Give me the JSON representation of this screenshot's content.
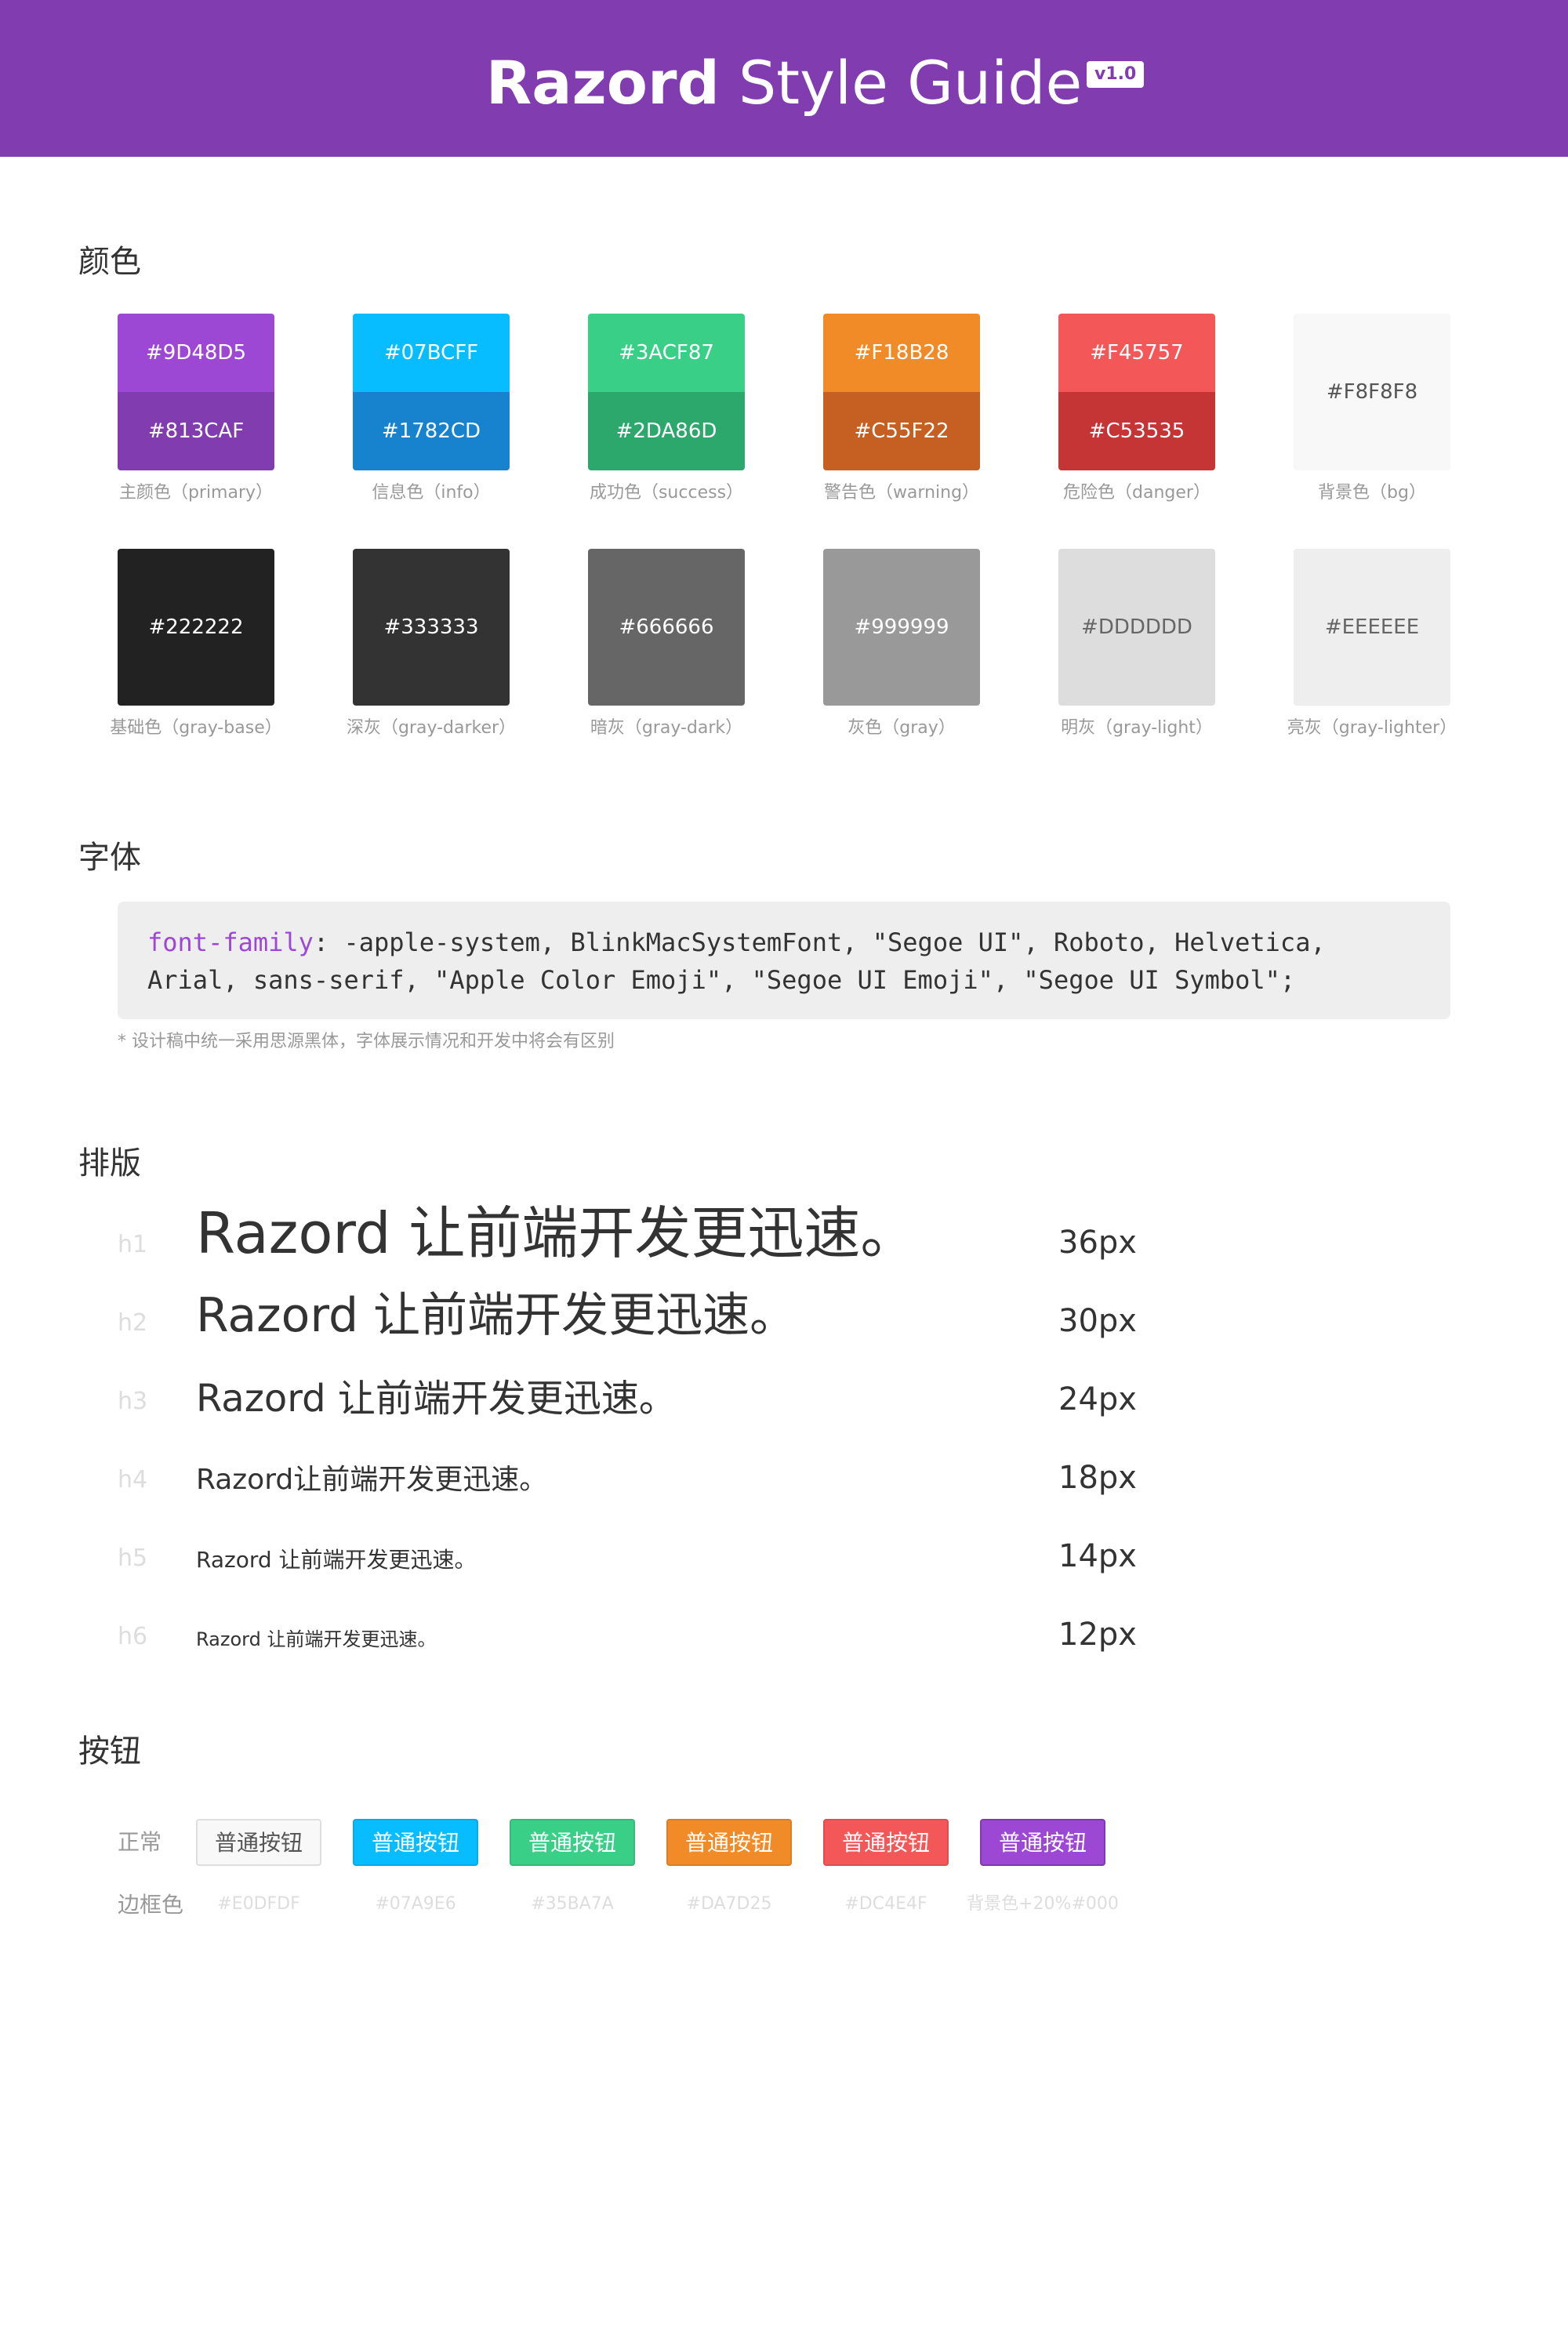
{
  "header": {
    "title_bold": "Razord",
    "title_light": "Style Guide",
    "version": "v1.0",
    "background": "#813CAF"
  },
  "colors_section": {
    "title": "颜色",
    "swatches_top": [
      {
        "top_value": "#9D48D5",
        "bottom_value": "#813CAF",
        "caption": "主颜色（primary）"
      },
      {
        "top_value": "#07BCFF",
        "bottom_value": "#1782CD",
        "caption": "信息色（info）"
      },
      {
        "top_value": "#3ACF87",
        "bottom_value": "#2DA86D",
        "caption": "成功色（success）"
      },
      {
        "top_value": "#F18B28",
        "bottom_value": "#C55F22",
        "caption": "警告色（warning）"
      },
      {
        "top_value": "#F45757",
        "bottom_value": "#C53535",
        "caption": "危险色（danger）"
      },
      {
        "value": "#F8F8F8",
        "caption": "背景色（bg）"
      }
    ],
    "swatches_gray": [
      {
        "value": "#222222",
        "caption": "基础色（gray-base）"
      },
      {
        "value": "#333333",
        "caption": "深灰（gray-darker）"
      },
      {
        "value": "#666666",
        "caption": "暗灰（gray-dark）"
      },
      {
        "value": "#999999",
        "caption": "灰色（gray）"
      },
      {
        "value": "#DDDDDD",
        "caption": "明灰（gray-light）"
      },
      {
        "value": "#EEEEEE",
        "caption": "亮灰（gray-lighter）"
      }
    ]
  },
  "font_section": {
    "title": "字体",
    "keyword": "font-family",
    "line1_rest": ": -apple-system, BlinkMacSystemFont, \"Segoe UI\", Roboto, Helvetica,",
    "line2": "Arial, sans-serif, \"Apple Color Emoji\", \"Segoe UI Emoji\", \"Segoe UI Symbol\";",
    "note": "* 设计稿中统一采用思源黑体，字体展示情况和开发中将会有区别"
  },
  "typography_section": {
    "title": "排版",
    "rows": [
      {
        "label": "h1",
        "sample": "Razord 让前端开发更迅速。",
        "size": "36px"
      },
      {
        "label": "h2",
        "sample": "Razord 让前端开发更迅速。",
        "size": "30px"
      },
      {
        "label": "h3",
        "sample": "Razord 让前端开发更迅速。",
        "size": "24px"
      },
      {
        "label": "h4",
        "sample": "Razord让前端开发更迅速。",
        "size": "18px"
      },
      {
        "label": "h5",
        "sample": "Razord 让前端开发更迅速。",
        "size": "14px"
      },
      {
        "label": "h6",
        "sample": "Razord 让前端开发更迅速。",
        "size": "12px"
      }
    ]
  },
  "buttons_section": {
    "title": "按钮",
    "normal_label": "正常",
    "border_label": "边框色",
    "buttons": [
      {
        "label": "普通按钮",
        "border_color": "#E0DFDF"
      },
      {
        "label": "普通按钮",
        "border_color": "#07A9E6"
      },
      {
        "label": "普通按钮",
        "border_color": "#35BA7A"
      },
      {
        "label": "普通按钮",
        "border_color": "#DA7D25"
      },
      {
        "label": "普通按钮",
        "border_color": "#DC4E4F"
      },
      {
        "label": "普通按钮",
        "border_color": "背景色+20%#000"
      }
    ]
  }
}
